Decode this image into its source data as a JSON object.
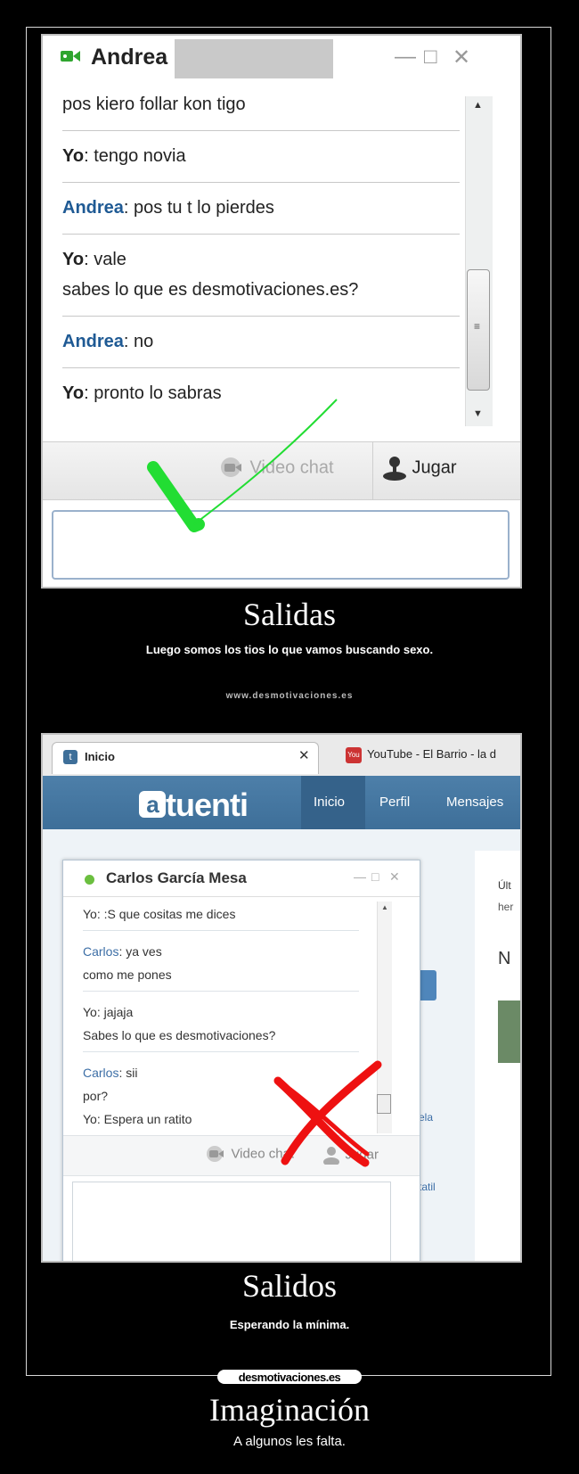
{
  "panel1": {
    "contact_name": "Andrea",
    "messages": [
      {
        "who": "",
        "text": "pos kiero follar kon tigo"
      },
      {
        "who": "Yo",
        "text": ": tengo novia"
      },
      {
        "who": "Andrea",
        "text": ": pos tu t lo pierdes"
      },
      {
        "who": "Yo",
        "text": ": vale"
      },
      {
        "who": "",
        "text": "sabes lo que es desmotivaciones.es?"
      },
      {
        "who": "Andrea",
        "text": ": no"
      },
      {
        "who": "Yo",
        "text": ": pronto lo sabras"
      }
    ],
    "video_chat_label": "Video chat",
    "jugar_label": "Jugar",
    "mark": "check",
    "mark_color": "#22dd33"
  },
  "caption1": {
    "title": "Salidas",
    "subtitle": "Luego somos los tios lo que vamos buscando sexo.",
    "url": "www.desmotivaciones.es"
  },
  "panel2": {
    "tab_label": "Inicio",
    "tab2_label": "YouTube - El Barrio - la d",
    "logo": "tuenti",
    "nav": [
      "Inicio",
      "Perfil",
      "Mensajes"
    ],
    "contact_name": "Carlos García Mesa",
    "messages": [
      {
        "who": "Yo",
        "text": ": :S que cositas me dices"
      },
      {
        "who": "Carlos",
        "text": ": ya ves"
      },
      {
        "who": "",
        "text": "como me pones"
      },
      {
        "who": "Yo",
        "text": ": jajaja"
      },
      {
        "who": "",
        "text": "Sabes lo que es desmotivaciones?"
      },
      {
        "who": "Carlos",
        "text": ": sii"
      },
      {
        "who": "",
        "text": "por?"
      },
      {
        "who": "Yo",
        "text": ": Espera un ratito"
      }
    ],
    "video_chat_label": "Video chat",
    "jugar_label": "Jugar",
    "side_fragments": [
      "Últ",
      "her",
      "N",
      "ela",
      "tatil"
    ],
    "mark": "cross",
    "mark_color": "#ee1111"
  },
  "caption2": {
    "title": "Salidos",
    "subtitle": "Esperando la mínima."
  },
  "footer": {
    "logo": "desmotivaciones.es",
    "title": "Imaginación",
    "subtitle": "A algunos les falta."
  }
}
